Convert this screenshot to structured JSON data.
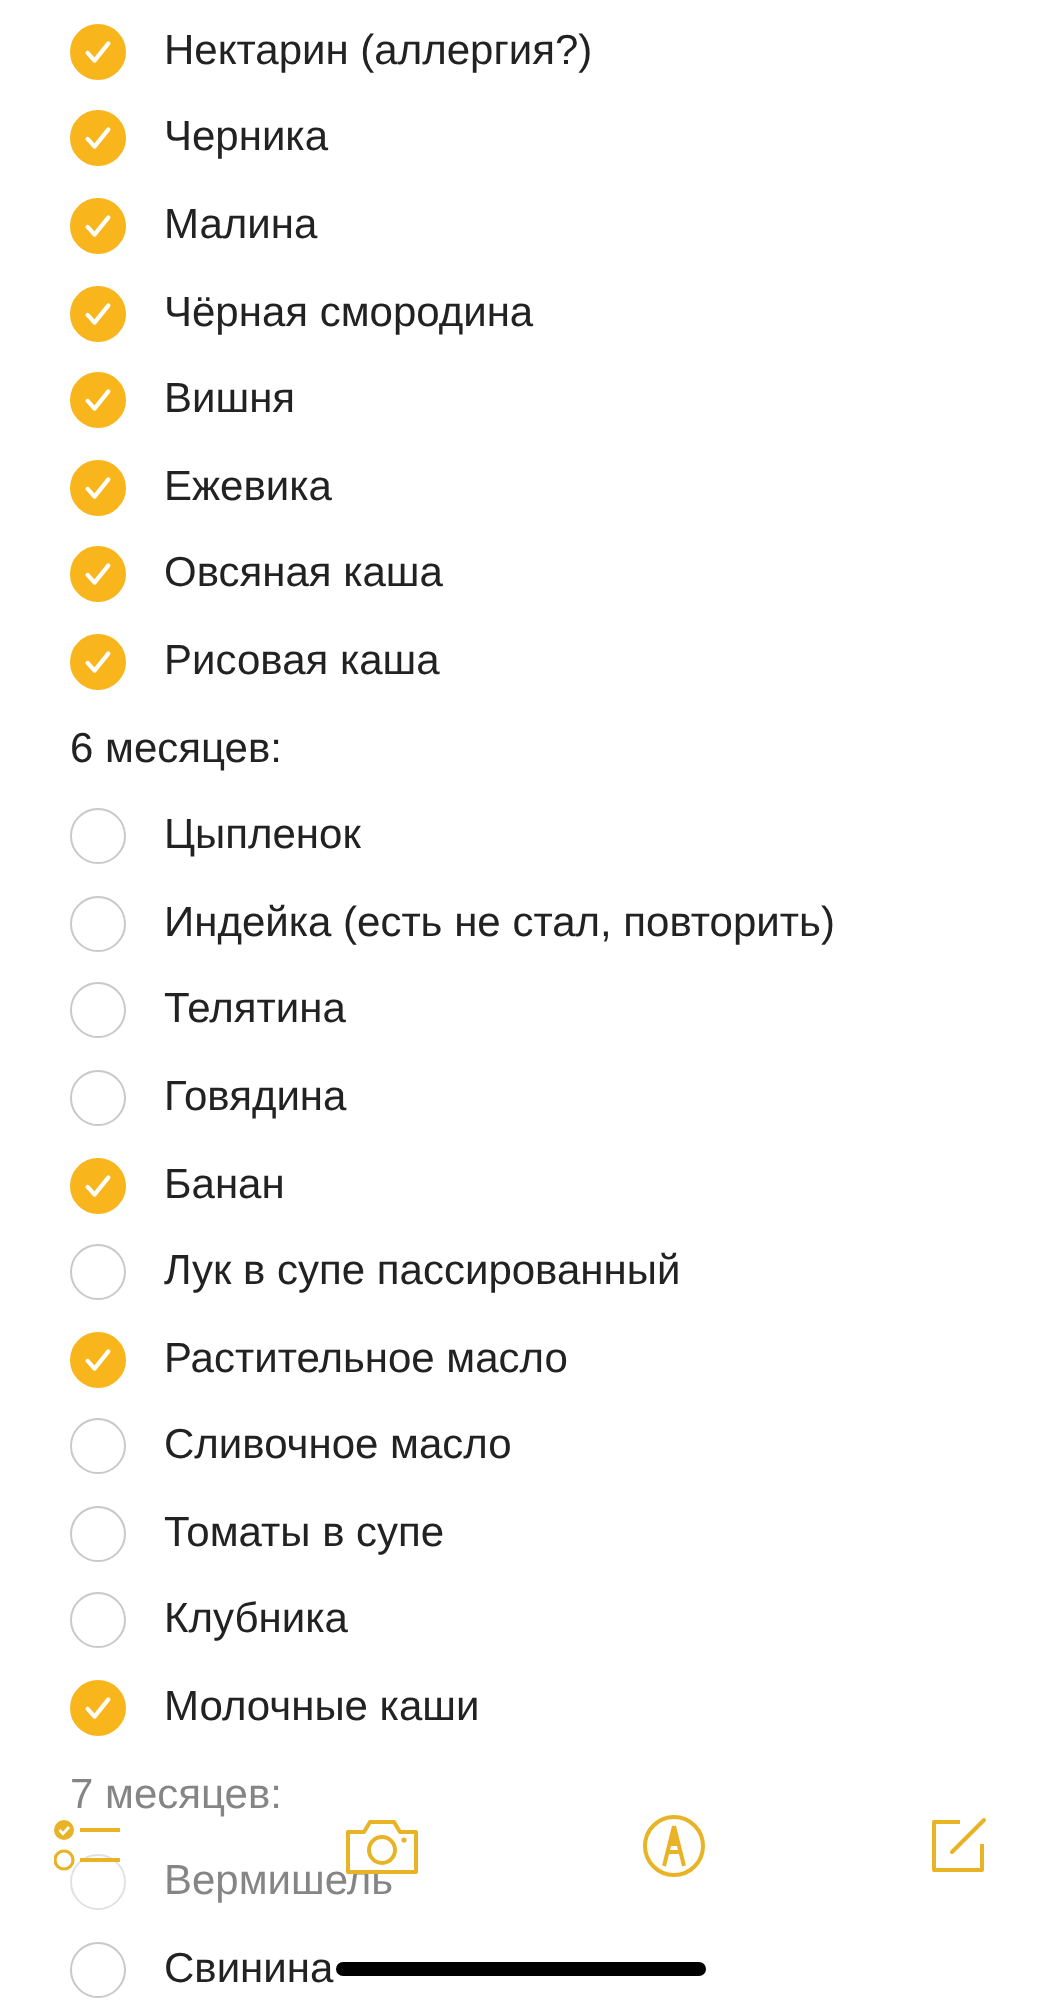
{
  "note": {
    "lines": [
      {
        "kind": "item",
        "text": "Нектарин (аллергия?)",
        "checked": true
      },
      {
        "kind": "item",
        "text": "Черника",
        "checked": true
      },
      {
        "kind": "item",
        "text": "Малина",
        "checked": true
      },
      {
        "kind": "item",
        "text": "Чёрная смородина",
        "checked": true
      },
      {
        "kind": "item",
        "text": "Вишня",
        "checked": true
      },
      {
        "kind": "item",
        "text": "Ежевика",
        "checked": true
      },
      {
        "kind": "item",
        "text": "Овсяная каша",
        "checked": true
      },
      {
        "kind": "item",
        "text": "Рисовая каша",
        "checked": true
      },
      {
        "kind": "header",
        "text": "6 месяцев:"
      },
      {
        "kind": "item",
        "text": "Цыпленок",
        "checked": false
      },
      {
        "kind": "item",
        "text": "Индейка (есть не стал, повторить)",
        "checked": false
      },
      {
        "kind": "item",
        "text": "Телятина",
        "checked": false
      },
      {
        "kind": "item",
        "text": "Говядина",
        "checked": false
      },
      {
        "kind": "item",
        "text": "Банан",
        "checked": true
      },
      {
        "kind": "item",
        "text": "Лук в супе пассированный",
        "checked": false
      },
      {
        "kind": "item",
        "text": "Растительное масло",
        "checked": true
      },
      {
        "kind": "item",
        "text": "Сливочное масло",
        "checked": false
      },
      {
        "kind": "item",
        "text": "Томаты в супе",
        "checked": false
      },
      {
        "kind": "item",
        "text": "Клубника",
        "checked": false
      },
      {
        "kind": "item",
        "text": "Молочные каши",
        "checked": true
      },
      {
        "kind": "header",
        "text": "7 месяцев:"
      },
      {
        "kind": "item",
        "text": "Вермишель",
        "checked": false
      },
      {
        "kind": "item",
        "text": "Свинина",
        "checked": false
      }
    ]
  }
}
